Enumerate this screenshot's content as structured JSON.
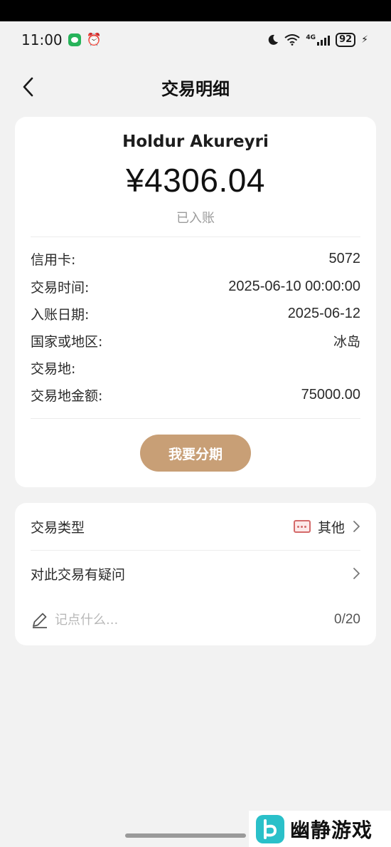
{
  "status_bar": {
    "time": "11:00",
    "network": "4G",
    "battery": "92"
  },
  "nav": {
    "title": "交易明细"
  },
  "transaction": {
    "merchant": "Holdur Akureyri",
    "amount": "¥4306.04",
    "status": "已入账"
  },
  "details": [
    {
      "label": "信用卡:",
      "value": "5072"
    },
    {
      "label": "交易时间:",
      "value": "2025-06-10 00:00:00"
    },
    {
      "label": "入账日期:",
      "value": "2025-06-12"
    },
    {
      "label": "国家或地区:",
      "value": "冰岛"
    },
    {
      "label": "交易地:",
      "value": ""
    },
    {
      "label": "交易地金额:",
      "value": "75000.00"
    }
  ],
  "installment_button": "我要分期",
  "options": {
    "type_label": "交易类型",
    "type_value": "其他",
    "dispute_label": "对此交易有疑问"
  },
  "note": {
    "placeholder": "记点什么...",
    "count": "0/20"
  },
  "watermark": {
    "text": "幽静游戏"
  },
  "colors": {
    "background": "#f2f2f2",
    "card": "#ffffff",
    "installment_button": "#c89f76",
    "muted_text": "#9b9b9b",
    "type_icon": "#d46a6a"
  }
}
